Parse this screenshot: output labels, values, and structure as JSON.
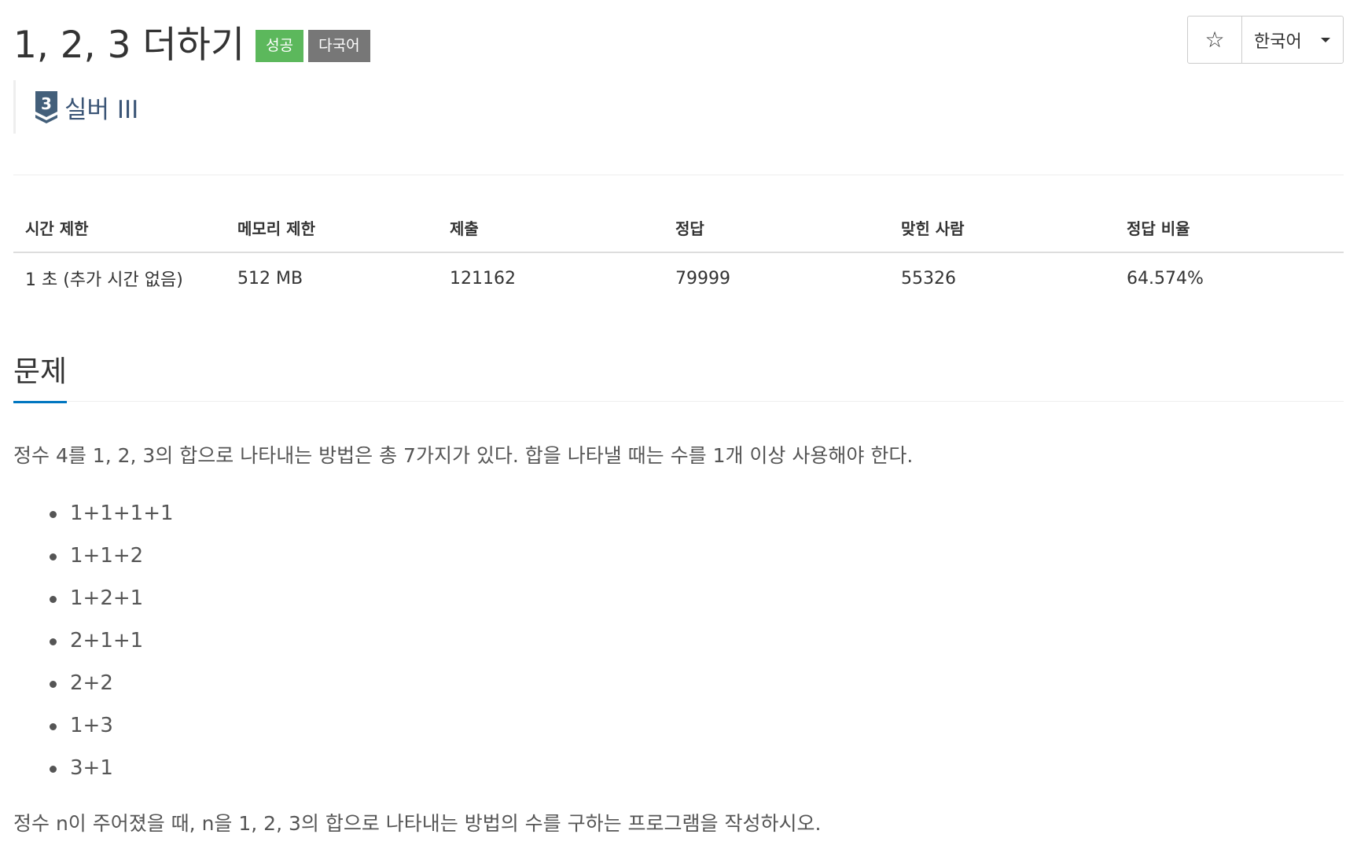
{
  "problem": {
    "title": "1, 2, 3 더하기",
    "badges": {
      "result": "성공",
      "language": "다국어"
    },
    "tier": {
      "level_number": "3",
      "label": "실버 III",
      "color": "#3b5576"
    }
  },
  "controls": {
    "star_glyph": "☆",
    "star_icon": "star-outline-icon",
    "language_label": "한국어"
  },
  "stats": {
    "headers": [
      "시간 제한",
      "메모리 제한",
      "제출",
      "정답",
      "맞힌 사람",
      "정답 비율"
    ],
    "values": [
      "1 초 (추가 시간 없음)",
      "512 MB",
      "121162",
      "79999",
      "55326",
      "64.574%"
    ]
  },
  "section": {
    "title": "문제",
    "accent_color": "#0076c0",
    "intro": "정수 4를 1, 2, 3의 합으로 나타내는 방법은 총 7가지가 있다. 합을 나타낼 때는 수를 1개 이상 사용해야 한다.",
    "items": [
      "1+1+1+1",
      "1+1+2",
      "1+2+1",
      "2+1+1",
      "2+2",
      "1+3",
      "3+1"
    ],
    "outro": "정수 n이 주어졌을 때, n을 1, 2, 3의 합으로 나타내는 방법의 수를 구하는 프로그램을 작성하시오."
  },
  "colors": {
    "success_badge": "#5cb85c",
    "language_badge": "#777777"
  }
}
